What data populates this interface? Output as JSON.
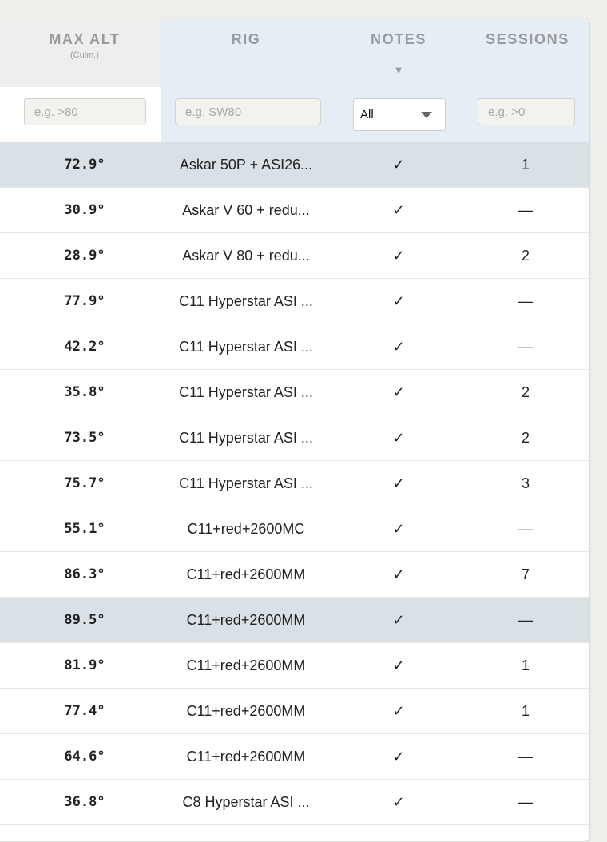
{
  "header": {
    "max_alt": "MAX ALT",
    "max_alt_sub": "(Culm.)",
    "rig": "RIG",
    "notes": "NOTES",
    "notes_sort": "▼",
    "sessions": "SESSIONS"
  },
  "filters": {
    "max_alt_placeholder": "e.g. >80",
    "rig_placeholder": "e.g. SW80",
    "notes_selected": "All",
    "sessions_placeholder": "e.g. >0"
  },
  "rows": [
    {
      "max_alt": "72.9°",
      "rig": "Askar 50P + ASI26...",
      "notes": "✓",
      "sessions": "1"
    },
    {
      "max_alt": "30.9°",
      "rig": "Askar V 60 + redu...",
      "notes": "✓",
      "sessions": "—"
    },
    {
      "max_alt": "28.9°",
      "rig": "Askar V 80 + redu...",
      "notes": "✓",
      "sessions": "2"
    },
    {
      "max_alt": "77.9°",
      "rig": "C11 Hyperstar ASI ...",
      "notes": "✓",
      "sessions": "—"
    },
    {
      "max_alt": "42.2°",
      "rig": "C11 Hyperstar ASI ...",
      "notes": "✓",
      "sessions": "—"
    },
    {
      "max_alt": "35.8°",
      "rig": "C11 Hyperstar ASI ...",
      "notes": "✓",
      "sessions": "2"
    },
    {
      "max_alt": "73.5°",
      "rig": "C11 Hyperstar ASI ...",
      "notes": "✓",
      "sessions": "2"
    },
    {
      "max_alt": "75.7°",
      "rig": "C11 Hyperstar ASI ...",
      "notes": "✓",
      "sessions": "3"
    },
    {
      "max_alt": "55.1°",
      "rig": "C11+red+2600MC",
      "notes": "✓",
      "sessions": "—"
    },
    {
      "max_alt": "86.3°",
      "rig": "C11+red+2600MM",
      "notes": "✓",
      "sessions": "7"
    },
    {
      "max_alt": "89.5°",
      "rig": "C11+red+2600MM",
      "notes": "✓",
      "sessions": "—"
    },
    {
      "max_alt": "81.9°",
      "rig": "C11+red+2600MM",
      "notes": "✓",
      "sessions": "1"
    },
    {
      "max_alt": "77.4°",
      "rig": "C11+red+2600MM",
      "notes": "✓",
      "sessions": "1"
    },
    {
      "max_alt": "64.6°",
      "rig": "C11+red+2600MM",
      "notes": "✓",
      "sessions": "—"
    },
    {
      "max_alt": "36.8°",
      "rig": "C8 Hyperstar ASI ...",
      "notes": "✓",
      "sessions": "—"
    }
  ],
  "highlighted_rows": [
    0,
    10
  ],
  "colors": {
    "rig_column_bg": "#e6eef5",
    "highlight_row_bg": "#d9e1e7",
    "header_text": "#9a9a9a",
    "page_bg": "#efeeeb"
  }
}
